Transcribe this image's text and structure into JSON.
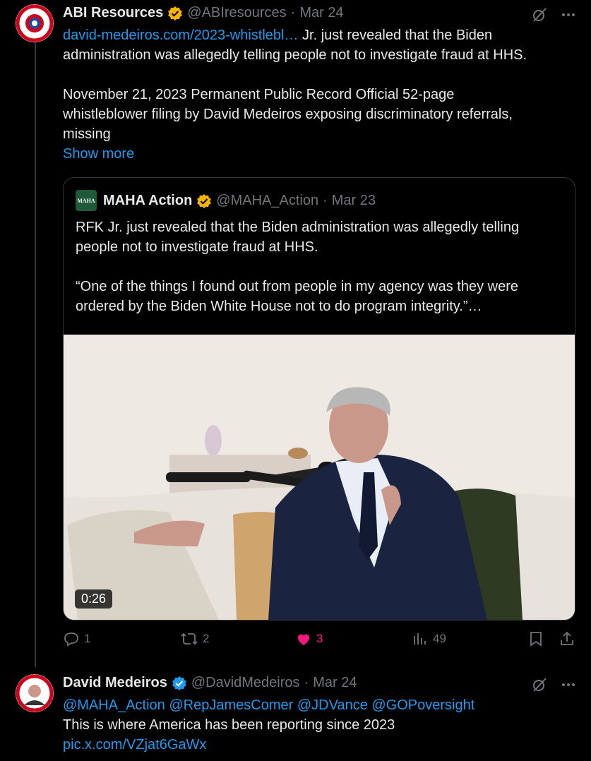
{
  "tweet1": {
    "name": "ABI Resources",
    "handle": "@ABIresources",
    "date": "Mar 24",
    "link_text": "david-medeiros.com/2023-whistlebl…",
    "text_line1_rest": " Jr. just revealed that the Biden",
    "text_line2": "administration was allegedly telling people not to investigate fraud at HHS.",
    "para2_line1": "November 21, 2023 Permanent Public Record  Official 52-page",
    "para2_line2": "whistleblower filing by David Medeiros exposing discriminatory referrals,",
    "para2_line3": "missing",
    "show_more": "Show more",
    "quote": {
      "name": "MAHA Action",
      "handle": "@MAHA_Action",
      "date": "Mar 23",
      "avatar_text": "MAHA",
      "line1": "RFK Jr. just revealed that the Biden administration was allegedly telling",
      "line2": "people not to investigate fraud at HHS.",
      "line3": "“One of the things I found out from people in my agency was they were",
      "line4": "ordered by the Biden White House not to do program integrity.”…",
      "video_duration": "0:26"
    },
    "actions": {
      "replies": "1",
      "reposts": "2",
      "likes": "3",
      "views": "49"
    }
  },
  "tweet2": {
    "name": "David Medeiros",
    "handle": "@DavidMedeiros",
    "date": "Mar 24",
    "mentions": [
      "@MAHA_Action",
      "@RepJamesComer",
      "@JDVance",
      "@GOPoversight"
    ],
    "text": "This is where America has been reporting since 2023",
    "pic_link": "pic.x.com/VZjat6GaWx"
  },
  "colors": {
    "link": "#1d9bf0",
    "gold_badge": "#f4b400",
    "blue_badge": "#1d9bf0",
    "like": "#f91880",
    "muted": "#71767b"
  }
}
